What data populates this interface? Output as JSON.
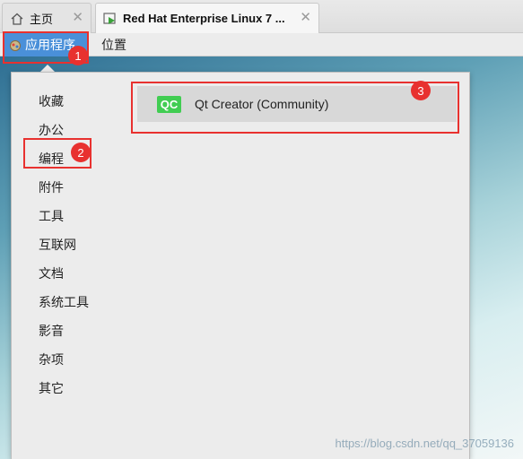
{
  "tabs": [
    {
      "label": "主页",
      "icon": "home-icon",
      "close": "✕"
    },
    {
      "label": "Red Hat Enterprise Linux 7 ...",
      "icon": "vm-icon",
      "close": "✕"
    }
  ],
  "panel": {
    "apps_menu_label": "应用程序",
    "places_label": "位置"
  },
  "menu": {
    "categories": [
      "收藏",
      "办公",
      "编程",
      "附件",
      "工具",
      "互联网",
      "文档",
      "系统工具",
      "影音",
      "杂项",
      "其它"
    ],
    "selected_category": "编程",
    "app_items": [
      {
        "label": "Qt Creator (Community)",
        "icon_text": "QC",
        "icon": "qt-creator-icon"
      }
    ]
  },
  "annotations": [
    "1",
    "2",
    "3"
  ],
  "watermark": "https://blog.csdn.net/qq_37059136",
  "colors": {
    "accent": "#4a90d9",
    "annotation_red": "#e8312f",
    "qt_green": "#41cd52"
  }
}
